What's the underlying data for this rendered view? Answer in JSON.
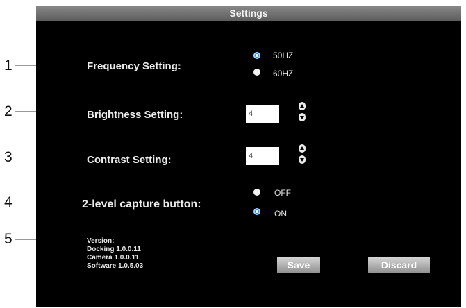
{
  "window": {
    "title": "Settings"
  },
  "callouts": [
    "1",
    "2",
    "3",
    "4",
    "5"
  ],
  "frequency": {
    "label": "Frequency Setting:",
    "options": [
      {
        "label": "50HZ",
        "selected": true
      },
      {
        "label": "60HZ",
        "selected": false
      }
    ]
  },
  "brightness": {
    "label": "Brightness Setting:",
    "value": "4"
  },
  "contrast": {
    "label": "Contrast Setting:",
    "value": "4"
  },
  "capture": {
    "label": "2-level capture button:",
    "options": [
      {
        "label": "OFF",
        "selected": false
      },
      {
        "label": "ON",
        "selected": true
      }
    ]
  },
  "version": {
    "heading": "Version:",
    "docking": "Docking 1.0.0.11",
    "camera": "Camera 1.0.0.11",
    "software": "Software 1.0.5.03"
  },
  "actions": {
    "save_label": "Save",
    "discard_label": "Discard"
  },
  "colors": {
    "panel_bg": "#000000",
    "radio_selected": "#2e7bd6",
    "titlebar": "#6e6e6e"
  }
}
